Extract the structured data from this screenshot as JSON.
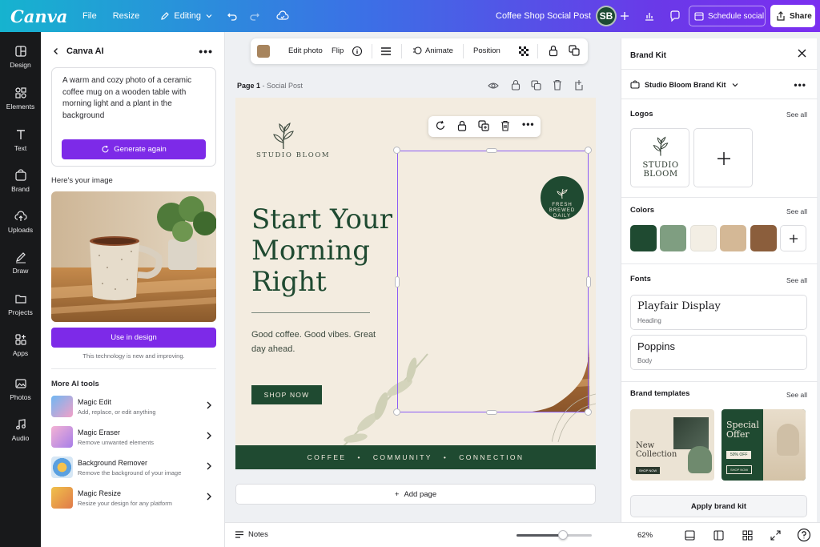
{
  "topbar": {
    "logo": "Canva",
    "file": "File",
    "resize": "Resize",
    "editing": "Editing",
    "doc_title": "Coffee Shop Social Post",
    "avatar": "SB",
    "schedule": "Schedule social",
    "share": "Share"
  },
  "rail": {
    "items": [
      {
        "label": "Design",
        "icon": "design-icon"
      },
      {
        "label": "Elements",
        "icon": "elements-icon"
      },
      {
        "label": "Text",
        "icon": "text-icon"
      },
      {
        "label": "Brand",
        "icon": "brand-icon"
      },
      {
        "label": "Uploads",
        "icon": "uploads-icon"
      },
      {
        "label": "Draw",
        "icon": "draw-icon"
      },
      {
        "label": "Projects",
        "icon": "projects-icon"
      },
      {
        "label": "Apps",
        "icon": "apps-icon"
      },
      {
        "label": "Photos",
        "icon": "photos-icon"
      },
      {
        "label": "Audio",
        "icon": "audio-icon"
      }
    ]
  },
  "ai_panel": {
    "title": "Canva AI",
    "prompt": "A warm and cozy photo of a ceramic coffee mug on a wooden table with morning light and a plant in the background",
    "generate_again": "Generate again",
    "result_label": "Here's your image",
    "use_in_design": "Use in design",
    "note": "This technology is new and improving.",
    "more_tools_label": "More AI tools",
    "tools": [
      {
        "name": "Magic Edit",
        "desc": "Add, replace, or edit anything"
      },
      {
        "name": "Magic Eraser",
        "desc": "Remove unwanted elements"
      },
      {
        "name": "Background Remover",
        "desc": "Remove the background of your image"
      },
      {
        "name": "Magic Resize",
        "desc": "Resize your design for any platform"
      }
    ]
  },
  "context_toolbar": {
    "edit_photo": "Edit photo",
    "flip": "Flip",
    "animate": "Animate",
    "position": "Position"
  },
  "page": {
    "label": "Page 1",
    "separator": " - ",
    "name": "Social Post"
  },
  "design": {
    "brand_name": "STUDIO BLOOM",
    "headline": "Start Your Morning Right",
    "tagline": "Good coffee. Good vibes. Great day ahead.",
    "cta": "SHOP NOW",
    "badge": "FRESH BREWED DAILY",
    "footer": [
      "COFFEE",
      "•",
      "COMMUNITY",
      "•",
      "CONNECTION"
    ]
  },
  "add_page": "Add page",
  "bottombar": {
    "notes": "Notes",
    "zoom": "62%",
    "zoom_fraction": 0.62
  },
  "brand_kit": {
    "title": "Brand Kit",
    "kit_name": "Studio Bloom Brand Kit",
    "logos_label": "Logos",
    "logo_text": "STUDIO BLOOM",
    "see_all": "See all",
    "colors_label": "Colors",
    "colors": [
      "#1f4a31",
      "#7f9e81",
      "#f3eee4",
      "#d4b896",
      "#8b5e3c"
    ],
    "fonts_label": "Fonts",
    "fonts": [
      {
        "name": "Playfair Display",
        "role": "Heading"
      },
      {
        "name": "Poppins",
        "role": "Body"
      }
    ],
    "templates_label": "Brand templates",
    "template1_title": "New Collection",
    "template1_btn": "SHOP NOW",
    "template2_title": "Special Offer",
    "template2_badge": "50% OFF",
    "template2_btn": "SHOP NOW",
    "apply": "Apply brand kit"
  }
}
